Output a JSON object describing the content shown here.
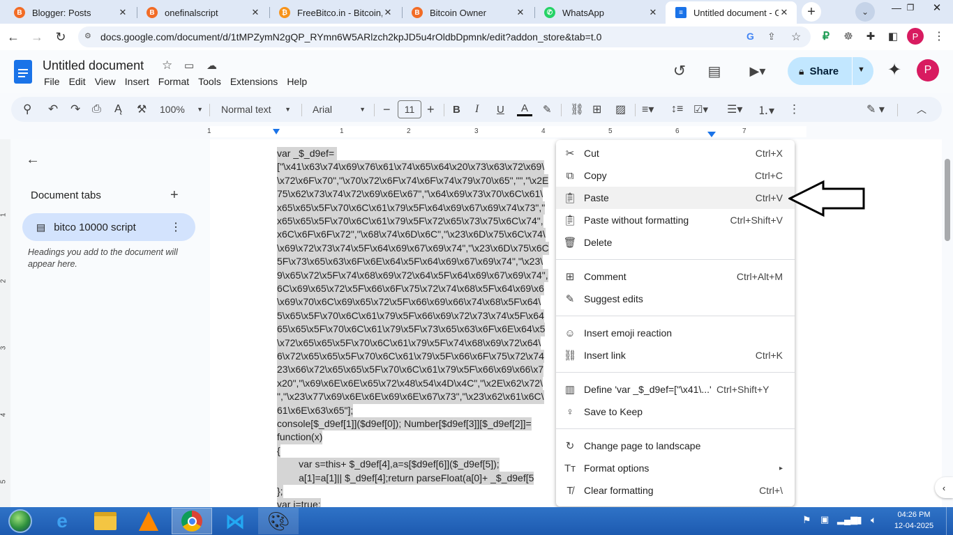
{
  "browser": {
    "tabs": [
      {
        "title": "Blogger: Posts",
        "icon": "blogger-icon",
        "color": "#f26c26"
      },
      {
        "title": "onefinalscript",
        "icon": "blogger-icon",
        "color": "#f26c26"
      },
      {
        "title": "FreeBitco.in - Bitcoin, Bi",
        "icon": "bitcoin-icon",
        "color": "#f7931a"
      },
      {
        "title": "Bitcoin Owner",
        "icon": "blogger-icon",
        "color": "#f26c26"
      },
      {
        "title": "WhatsApp",
        "icon": "whatsapp-icon",
        "color": "#25d366"
      },
      {
        "title": "Untitled document - Go",
        "icon": "docs-icon",
        "color": "#1a73e8"
      }
    ],
    "url": "docs.google.com/document/d/1tMPZymN2gQP_RYmn6W5ARlzch2kpJD5u4rOldbDpmnk/edit?addon_store&tab=t.0",
    "profile_initial": "P"
  },
  "doc": {
    "title": "Untitled document",
    "menu": [
      "File",
      "Edit",
      "View",
      "Insert",
      "Format",
      "Tools",
      "Extensions",
      "Help"
    ],
    "share_label": "Share",
    "avatar_initial": "P"
  },
  "toolbar": {
    "zoom": "100%",
    "style": "Normal text",
    "font": "Arial",
    "font_size": "11"
  },
  "ruler": {
    "numbers": [
      "1",
      "1",
      "2",
      "3",
      "4",
      "5",
      "6",
      "7"
    ]
  },
  "vruler": {
    "numbers": [
      "1",
      "2",
      "3",
      "4",
      "5"
    ]
  },
  "sidebar": {
    "heading": "Document tabs",
    "tab_name": "bitco 10000 script",
    "hint": "Headings you add to the document will appear here."
  },
  "code_lines": [
    "var _$_d9ef= ",
    "[\"\\x41\\x63\\x74\\x69\\x76\\x61\\x74\\x65\\x64\\x20\\x73\\x63\\x72\\x69\\",
    "\\x72\\x6F\\x70\",\"\\x70\\x72\\x6F\\x74\\x6F\\x74\\x79\\x70\\x65\",\"\",\"\\x2E",
    "75\\x62\\x73\\x74\\x72\\x69\\x6E\\x67\",\"\\x64\\x69\\x73\\x70\\x6C\\x61\\",
    "x65\\x65\\x5F\\x70\\x6C\\x61\\x79\\x5F\\x64\\x69\\x67\\x69\\x74\\x73\",\"",
    "x65\\x65\\x5F\\x70\\x6C\\x61\\x79\\x5F\\x72\\x65\\x73\\x75\\x6C\\x74\",",
    "x6C\\x6F\\x6F\\x72\",\"\\x68\\x74\\x6D\\x6C\",\"\\x23\\x6D\\x75\\x6C\\x74\\",
    "\\x69\\x72\\x73\\x74\\x5F\\x64\\x69\\x67\\x69\\x74\",\"\\x23\\x6D\\x75\\x6C",
    "5F\\x73\\x65\\x63\\x6F\\x6E\\x64\\x5F\\x64\\x69\\x67\\x69\\x74\",\"\\x23\\",
    "9\\x65\\x72\\x5F\\x74\\x68\\x69\\x72\\x64\\x5F\\x64\\x69\\x67\\x69\\x74\",",
    "6C\\x69\\x65\\x72\\x5F\\x66\\x6F\\x75\\x72\\x74\\x68\\x5F\\x64\\x69\\x6",
    "\\x69\\x70\\x6C\\x69\\x65\\x72\\x5F\\x66\\x69\\x66\\x74\\x68\\x5F\\x64\\",
    "5\\x65\\x5F\\x70\\x6C\\x61\\x79\\x5F\\x66\\x69\\x72\\x73\\x74\\x5F\\x64",
    "65\\x65\\x5F\\x70\\x6C\\x61\\x79\\x5F\\x73\\x65\\x63\\x6F\\x6E\\x64\\x5",
    "\\x72\\x65\\x65\\x5F\\x70\\x6C\\x61\\x79\\x5F\\x74\\x68\\x69\\x72\\x64\\",
    "6\\x72\\x65\\x65\\x5F\\x70\\x6C\\x61\\x79\\x5F\\x66\\x6F\\x75\\x72\\x74",
    "23\\x66\\x72\\x65\\x65\\x5F\\x70\\x6C\\x61\\x79\\x5F\\x66\\x69\\x66\\x7",
    "x20\",\"\\x69\\x6E\\x6E\\x65\\x72\\x48\\x54\\x4D\\x4C\",\"\\x2E\\x62\\x72\\",
    "\",\"\\x23\\x77\\x69\\x6E\\x6E\\x69\\x6E\\x67\\x73\",\"\\x23\\x62\\x61\\x6C\\",
    "61\\x6E\\x63\\x65\"];",
    "console[$_d9ef[1]]($d9ef[0]); Number[$d9ef[3]][$_d9ef[2]]=",
    "function(x)",
    "{",
    "        var s=this+ $_d9ef[4],a=s[$d9ef[6]]($_d9ef[5]);",
    "        a[1]=a[1]|| $_d9ef[4];return parseFloat(a[0]+ _$_d9ef[5",
    "};",
    "var i=true;"
  ],
  "context_menu": {
    "items": [
      {
        "label": "Cut",
        "shortcut": "Ctrl+X",
        "icon": "scissors-icon"
      },
      {
        "label": "Copy",
        "shortcut": "Ctrl+C",
        "icon": "copy-icon"
      },
      {
        "label": "Paste",
        "shortcut": "Ctrl+V",
        "icon": "clipboard-icon"
      },
      {
        "label": "Paste without formatting",
        "shortcut": "Ctrl+Shift+V",
        "icon": "clipboard-text-icon"
      },
      {
        "label": "Delete",
        "shortcut": "",
        "icon": "trash-icon"
      },
      {
        "label": "Comment",
        "shortcut": "Ctrl+Alt+M",
        "icon": "add-comment-icon"
      },
      {
        "label": "Suggest edits",
        "shortcut": "",
        "icon": "suggest-edit-icon"
      },
      {
        "label": "Insert emoji reaction",
        "shortcut": "",
        "icon": "emoji-icon"
      },
      {
        "label": "Insert link",
        "shortcut": "Ctrl+K",
        "icon": "link-icon"
      },
      {
        "label": "Define 'var _$_d9ef=[\"\\x41\\...'",
        "shortcut": "Ctrl+Shift+Y",
        "icon": "book-icon"
      },
      {
        "label": "Save to Keep",
        "shortcut": "",
        "icon": "lightbulb-icon"
      },
      {
        "label": "Change page to landscape",
        "shortcut": "",
        "icon": "rotate-icon"
      },
      {
        "label": "Format options",
        "shortcut": "▸",
        "icon": "text-format-icon"
      },
      {
        "label": "Clear formatting",
        "shortcut": "Ctrl+\\",
        "icon": "clear-format-icon"
      }
    ]
  },
  "taskbar": {
    "time": "04:26 PM",
    "date": "12-04-2025"
  }
}
